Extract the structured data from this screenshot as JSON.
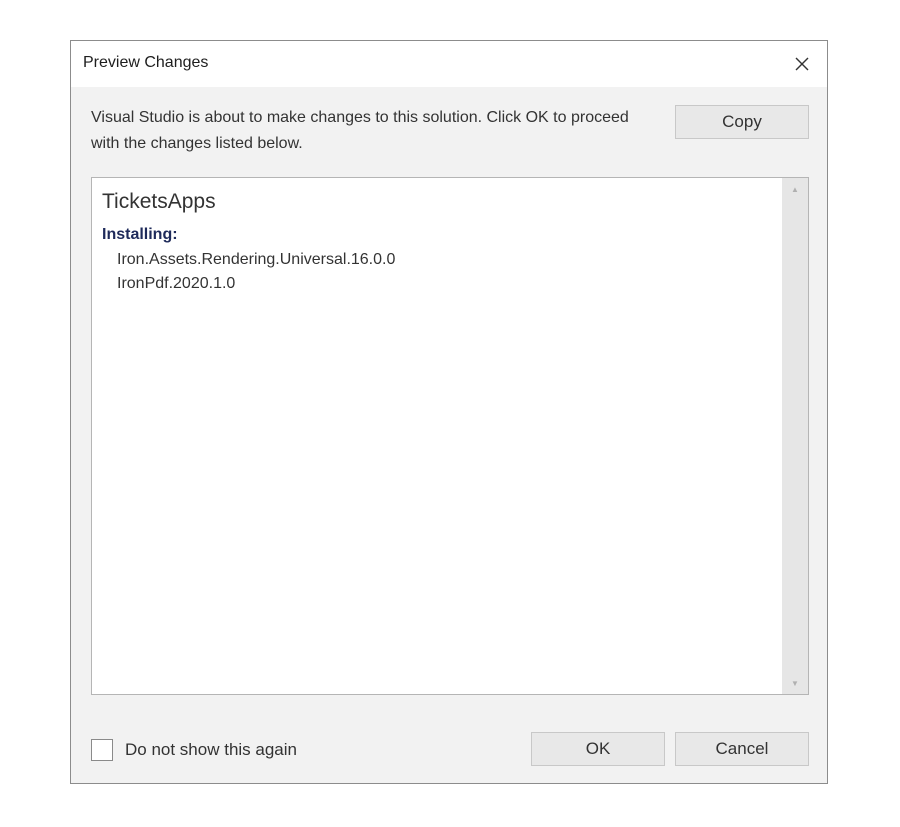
{
  "dialog": {
    "title": "Preview Changes",
    "description": "Visual Studio is about to make changes to this solution. Click OK to proceed with the changes listed below.",
    "copy_label": "Copy",
    "close_icon": "close-icon"
  },
  "changes": {
    "project": "TicketsApps",
    "section_heading": "Installing:",
    "packages": [
      "Iron.Assets.Rendering.Universal.16.0.0",
      "IronPdf.2020.1.0"
    ]
  },
  "footer": {
    "checkbox_label": "Do not show this again",
    "checkbox_checked": false,
    "ok_label": "OK",
    "cancel_label": "Cancel"
  }
}
